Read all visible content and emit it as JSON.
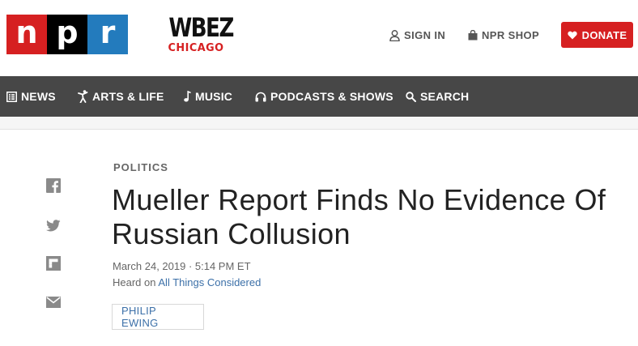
{
  "header": {
    "logo_letters": [
      "n",
      "p",
      "r"
    ],
    "station_name": "WBEZ",
    "station_city": "CHICAGO",
    "sign_in": "SIGN IN",
    "shop": "NPR SHOP",
    "donate": "DONATE"
  },
  "nav": {
    "items": [
      {
        "label": "NEWS",
        "icon": "news-grid-icon"
      },
      {
        "label": "ARTS & LIFE",
        "icon": "dancer-icon"
      },
      {
        "label": "MUSIC",
        "icon": "music-note-icon"
      },
      {
        "label": "PODCASTS & SHOWS",
        "icon": "headphones-icon"
      },
      {
        "label": "SEARCH",
        "icon": "search-icon"
      }
    ]
  },
  "share": [
    "facebook-icon",
    "twitter-icon",
    "flipboard-icon",
    "email-icon"
  ],
  "article": {
    "slug": "POLITICS",
    "headline": "Mueller Report Finds No Evidence Of Russian Collusion",
    "date": "March 24, 2019 · 5:14 PM ET",
    "heard_on_prefix": "Heard on",
    "heard_on_show": "All Things Considered",
    "byline": "PHILIP EWING"
  },
  "colors": {
    "npr_red": "#d62021",
    "npr_black": "#000000",
    "npr_blue": "#237bbd",
    "nav_bg": "#474747",
    "link": "#3c70a8"
  }
}
